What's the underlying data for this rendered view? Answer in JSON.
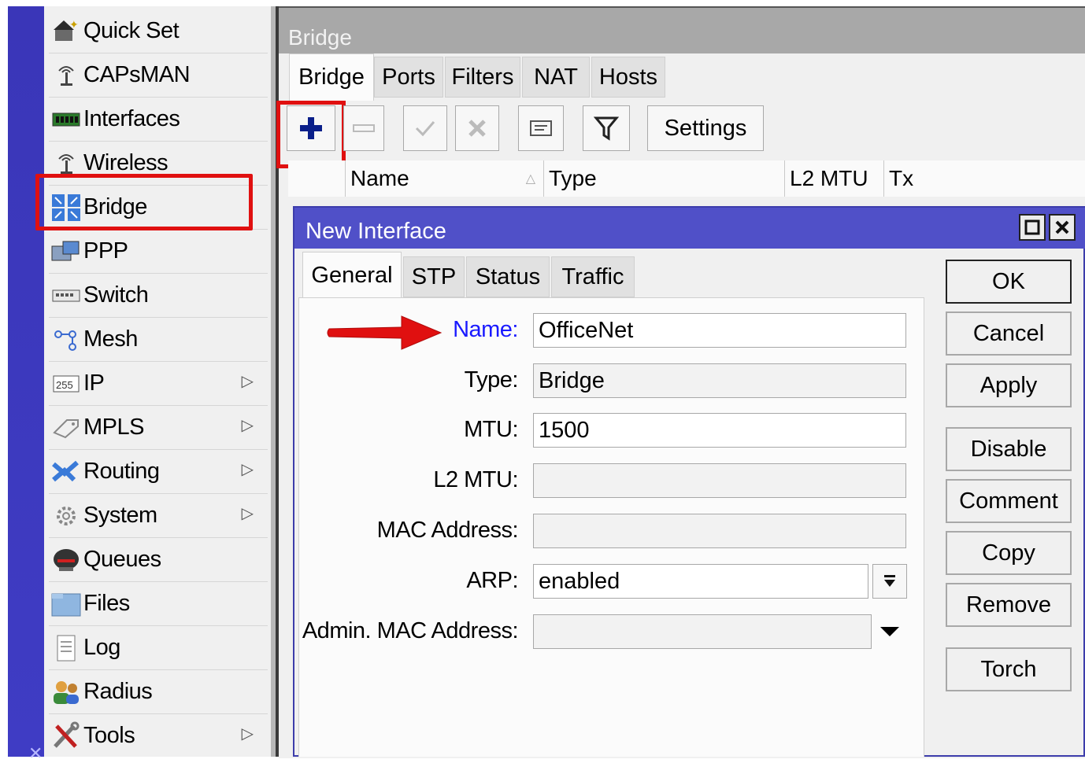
{
  "sidebar": {
    "items": [
      {
        "label": "Quick Set",
        "icon": "quick-set-icon",
        "submenu": false
      },
      {
        "label": "CAPsMAN",
        "icon": "capsman-icon",
        "submenu": false
      },
      {
        "label": "Interfaces",
        "icon": "interfaces-icon",
        "submenu": false
      },
      {
        "label": "Wireless",
        "icon": "wireless-icon",
        "submenu": false
      },
      {
        "label": "Bridge",
        "icon": "bridge-icon",
        "submenu": false,
        "highlighted": true
      },
      {
        "label": "PPP",
        "icon": "ppp-icon",
        "submenu": false
      },
      {
        "label": "Switch",
        "icon": "switch-icon",
        "submenu": false
      },
      {
        "label": "Mesh",
        "icon": "mesh-icon",
        "submenu": false
      },
      {
        "label": "IP",
        "icon": "ip-icon",
        "submenu": true,
        "icon_text": "255"
      },
      {
        "label": "MPLS",
        "icon": "mpls-icon",
        "submenu": true
      },
      {
        "label": "Routing",
        "icon": "routing-icon",
        "submenu": true
      },
      {
        "label": "System",
        "icon": "system-icon",
        "submenu": true
      },
      {
        "label": "Queues",
        "icon": "queues-icon",
        "submenu": false
      },
      {
        "label": "Files",
        "icon": "files-icon",
        "submenu": false
      },
      {
        "label": "Log",
        "icon": "log-icon",
        "submenu": false
      },
      {
        "label": "Radius",
        "icon": "radius-icon",
        "submenu": false
      },
      {
        "label": "Tools",
        "icon": "tools-icon",
        "submenu": true
      }
    ]
  },
  "bridge_window": {
    "title": "Bridge",
    "tabs": [
      "Bridge",
      "Ports",
      "Filters",
      "NAT",
      "Hosts"
    ],
    "active_tab": "Bridge",
    "toolbar": {
      "settings_label": "Settings"
    },
    "columns": [
      "Name",
      "Type",
      "L2 MTU",
      "Tx"
    ]
  },
  "dialog": {
    "title": "New Interface",
    "tabs": [
      "General",
      "STP",
      "Status",
      "Traffic"
    ],
    "active_tab": "General",
    "fields": {
      "name_label": "Name:",
      "name_value": "OfficeNet",
      "type_label": "Type:",
      "type_value": "Bridge",
      "mtu_label": "MTU:",
      "mtu_value": "1500",
      "l2mtu_label": "L2 MTU:",
      "l2mtu_value": "",
      "mac_label": "MAC Address:",
      "mac_value": "",
      "arp_label": "ARP:",
      "arp_value": "enabled",
      "admin_mac_label": "Admin. MAC Address:",
      "admin_mac_value": ""
    },
    "buttons": [
      "OK",
      "Cancel",
      "Apply",
      "Disable",
      "Comment",
      "Copy",
      "Remove",
      "Torch"
    ]
  },
  "colors": {
    "highlight_red": "#e01010",
    "dialog_title_blue": "#5050c8",
    "name_label_blue": "#1a1aff",
    "left_strip_blue": "#3a36b8"
  }
}
